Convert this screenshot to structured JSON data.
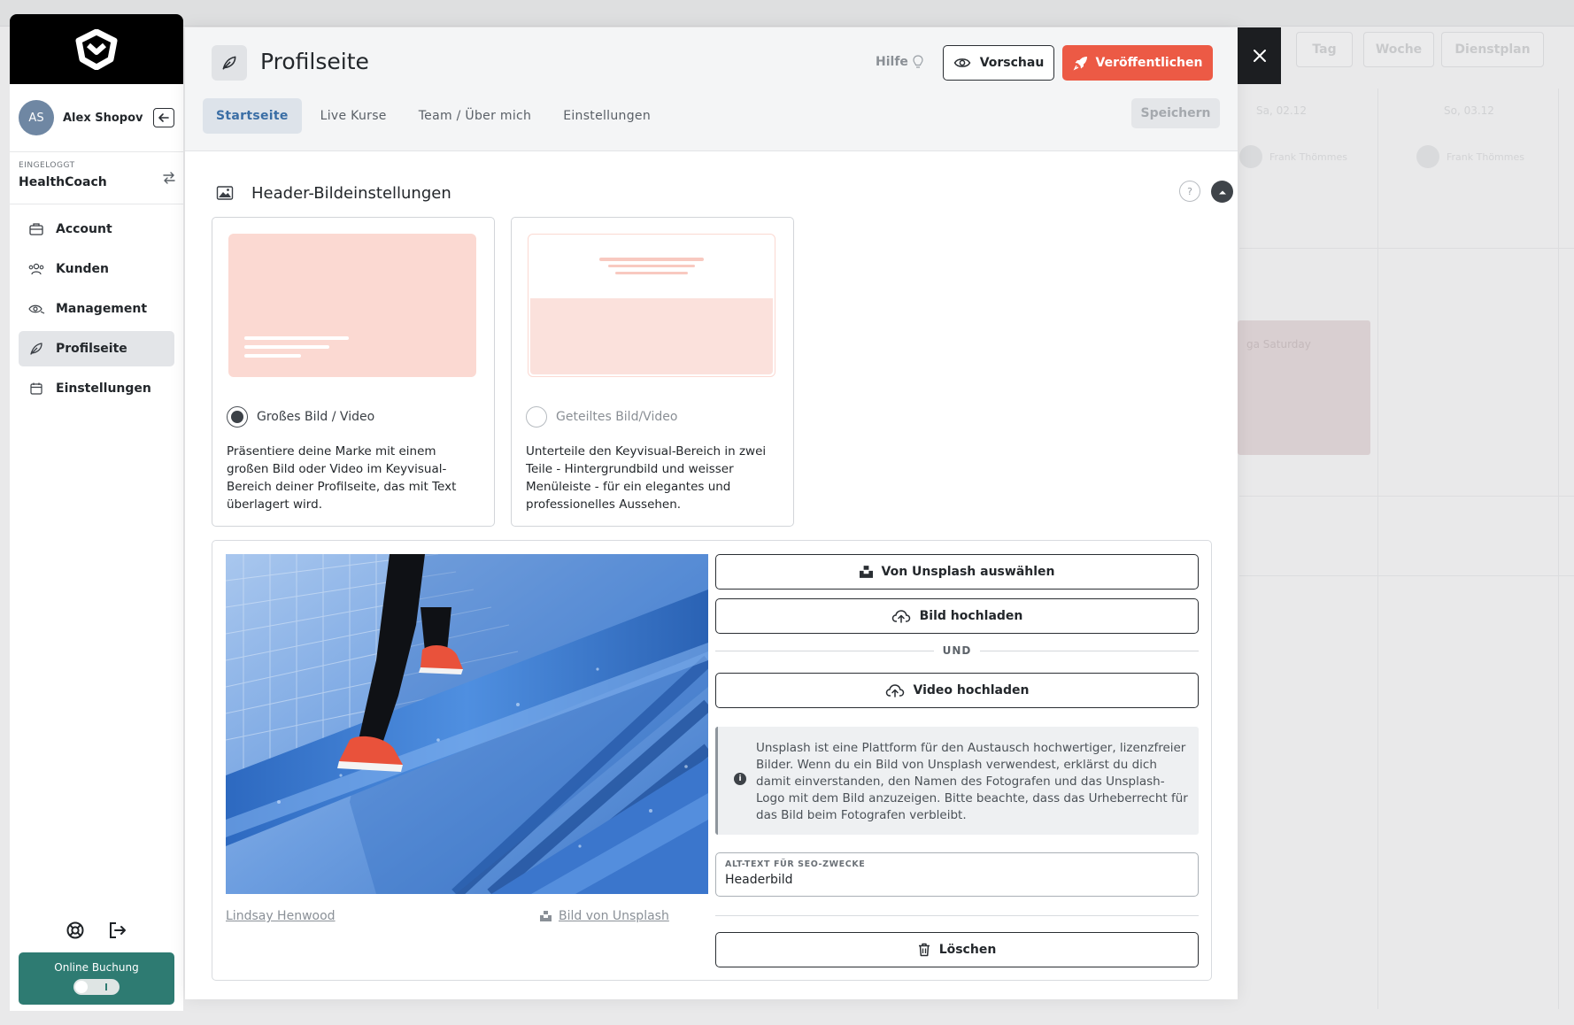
{
  "background": {
    "buttons": [
      "Tag",
      "Woche",
      "Dienstplan"
    ],
    "days": [
      "Sa, 02.12",
      "So, 03.12"
    ],
    "person": "Frank Thömmes",
    "event": "ga Saturday"
  },
  "sidebar": {
    "user": {
      "initials": "AS",
      "name": "Alex Shopov"
    },
    "logged_in_label": "EINGELOGGT",
    "account": "HealthCoach",
    "items": [
      {
        "label": "Account",
        "icon": "briefcase-icon"
      },
      {
        "label": "Kunden",
        "icon": "users-icon"
      },
      {
        "label": "Management",
        "icon": "eye-hand-icon"
      },
      {
        "label": "Profilseite",
        "icon": "feather-icon",
        "active": true
      },
      {
        "label": "Einstellungen",
        "icon": "calendar-icon"
      }
    ],
    "online_booking": "Online Buchung"
  },
  "modal": {
    "title": "Profilseite",
    "help": "Hilfe",
    "preview": "Vorschau",
    "publish": "Veröffentlichen",
    "save": "Speichern",
    "tabs": [
      {
        "label": "Startseite",
        "active": true
      },
      {
        "label": "Live Kurse"
      },
      {
        "label": "Team / Über mich"
      },
      {
        "label": "Einstellungen"
      }
    ],
    "section_title": "Header-Bildeinstellungen",
    "help_mark": "?",
    "layouts": [
      {
        "label": "Großes Bild / Video",
        "selected": true,
        "description": "Präsentiere deine Marke mit einem großen Bild oder Video im Keyvisual-Bereich deiner Profilseite, das mit Text überlagert wird."
      },
      {
        "label": "Geteiltes Bild/Video",
        "selected": false,
        "description": "Unterteile den Keyvisual-Bereich in zwei Teile - Hintergrundbild und weisser Menüleiste - für ein elegantes und professionelles Aussehen."
      }
    ],
    "media": {
      "unsplash_button": "Von Unsplash auswählen",
      "upload_image": "Bild hochladen",
      "and": "UND",
      "upload_video": "Video hochladen",
      "info": "Unsplash ist eine Plattform für den Austausch hochwertiger, lizenzfreier Bilder. Wenn du ein Bild von Unsplash verwendest, erklärst du dich damit einverstanden, den Namen des Fotografen und das Unsplash-Logo mit dem Bild anzuzeigen. Bitte beachte, dass das Urheberrecht für das Bild beim Fotografen verbleibt.",
      "alt_label": "ALT-TEXT FÜR SEO-ZWECKE",
      "alt_value": "Headerbild",
      "photographer": "Lindsay Henwood",
      "source": "Bild von Unsplash",
      "delete": "Löschen"
    }
  },
  "colors": {
    "brand_orange": "#ec5a45",
    "teal": "#2e7b72",
    "active_tab_text": "#3a6ea5",
    "preview_pink": "#fbd9d2"
  }
}
